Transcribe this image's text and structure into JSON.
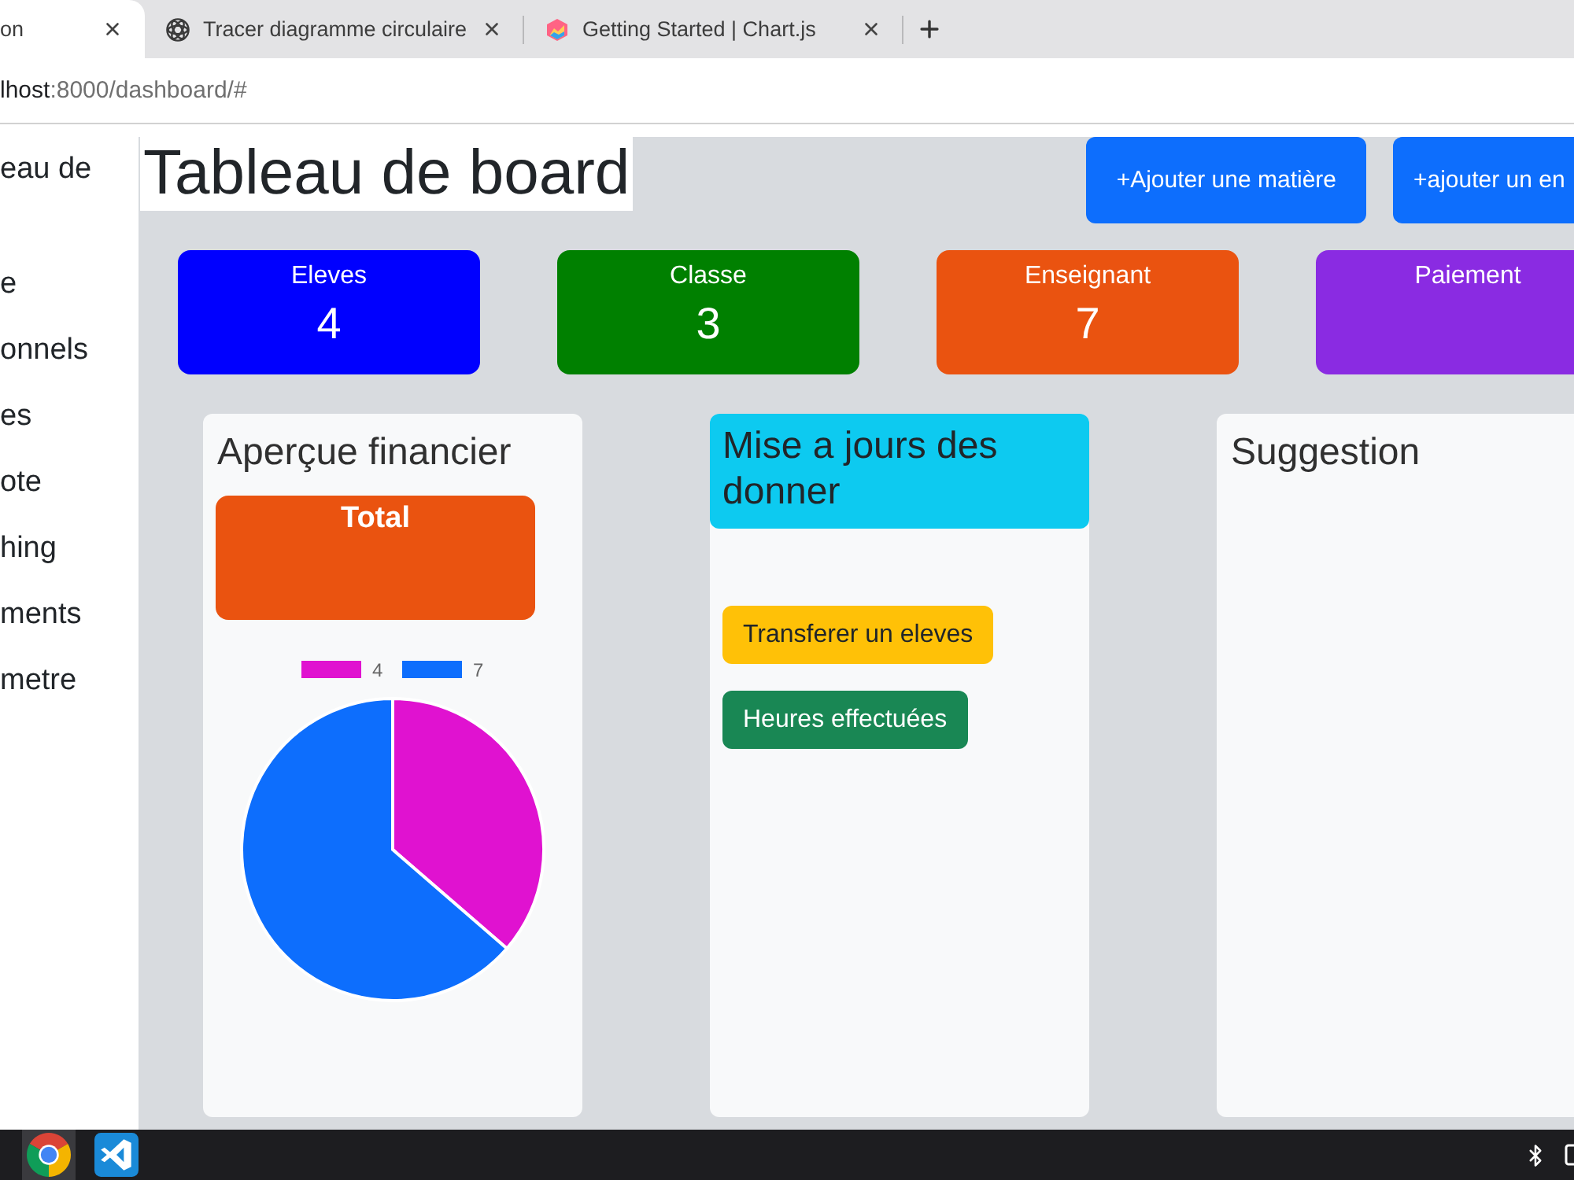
{
  "browser": {
    "tabs": [
      {
        "title": "on",
        "selected": true
      },
      {
        "title": "Tracer diagramme circulaire",
        "selected": false
      },
      {
        "title": "Getting Started | Chart.js",
        "selected": false
      }
    ],
    "address": {
      "host": "lhost",
      "path": ":8000/dashboard/#"
    }
  },
  "sidebar": {
    "brand": "eau de",
    "items": [
      {
        "label": "e"
      },
      {
        "label": "onnels"
      },
      {
        "label": "es"
      },
      {
        "label": "ote"
      },
      {
        "label": "hing"
      },
      {
        "label": "ments"
      },
      {
        "label": "metre"
      }
    ]
  },
  "header": {
    "title": "Tableau de board",
    "actions": [
      {
        "label": "+Ajouter une matière"
      },
      {
        "label": "+ajouter un en"
      }
    ]
  },
  "stats": [
    {
      "label": "Eleves",
      "value": "4",
      "color": "#0000ff"
    },
    {
      "label": "Classe",
      "value": "3",
      "color": "#008000"
    },
    {
      "label": "Enseignant",
      "value": "7",
      "color": "#ea5310"
    },
    {
      "label": "Paiement",
      "color": "#8a2be2"
    }
  ],
  "panels": [
    {
      "kind": "finance",
      "title": "Aperçue financier",
      "total_label": "Total",
      "chart_data": {
        "type": "pie",
        "categories": [
          "4",
          "7"
        ],
        "values": [
          4,
          7
        ],
        "colors": [
          "#e012d0",
          "#0d6efd"
        ],
        "legend": "top"
      }
    },
    {
      "kind": "updates",
      "title": "Mise a jours des donner",
      "buttons": [
        {
          "label": "Transferer un eleves",
          "color": "#ffc107"
        },
        {
          "label": "Heures effectuées",
          "color": "#198754"
        }
      ]
    },
    {
      "kind": "suggestion",
      "title": "Suggestion"
    }
  ],
  "taskbar": {
    "apps": [
      {
        "selected": true
      },
      {
        "selected": false
      }
    ]
  }
}
